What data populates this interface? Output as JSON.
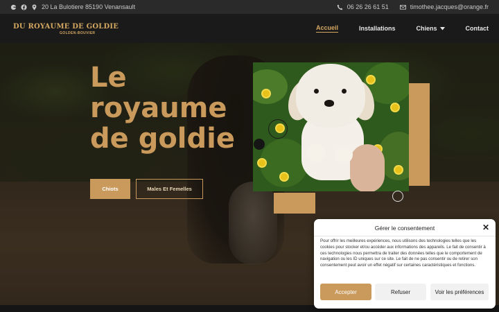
{
  "topbar": {
    "address": "20 La Bulotiere 85190 Venansault",
    "phone": "06 26 26 61 51",
    "email": "timothee.jacques@orange.fr",
    "icons": [
      "google-icon",
      "facebook-icon",
      "map-pin-icon",
      "phone-icon",
      "envelope-icon"
    ]
  },
  "logo": {
    "title": "DU ROYAUME DE GOLDIE",
    "subtitle": "GOLDEN-BOUVIER"
  },
  "nav": {
    "items": [
      {
        "label": "Accueil",
        "active": true
      },
      {
        "label": "Installations"
      },
      {
        "label": "Chiens"
      },
      {
        "label": "Contact"
      }
    ]
  },
  "hero": {
    "title_lines": [
      "Le",
      "royaume",
      "de goldie"
    ],
    "buttons": {
      "primary": "Chiots",
      "secondary": "Males Et Femelles"
    }
  },
  "cookie": {
    "title": "Gérer le consentement",
    "text": "Pour offrir les meilleures expériences, nous utilisons des technologies telles que les cookies pour stocker et/ou accéder aux informations des appareils. Le fait de consentir à ces technologies nous permettra de traiter des données telles que le comportement de navigation ou les ID uniques sur ce site. Le fait de ne pas consentir ou de retirer son consentement peut avoir un effet négatif sur certaines caractéristiques et fonctions.",
    "accept": "Accepter",
    "refuse": "Refuser",
    "prefs": "Voir les préférences"
  },
  "colors": {
    "accent": "#c99a5c",
    "dark": "#1a1a1a"
  }
}
